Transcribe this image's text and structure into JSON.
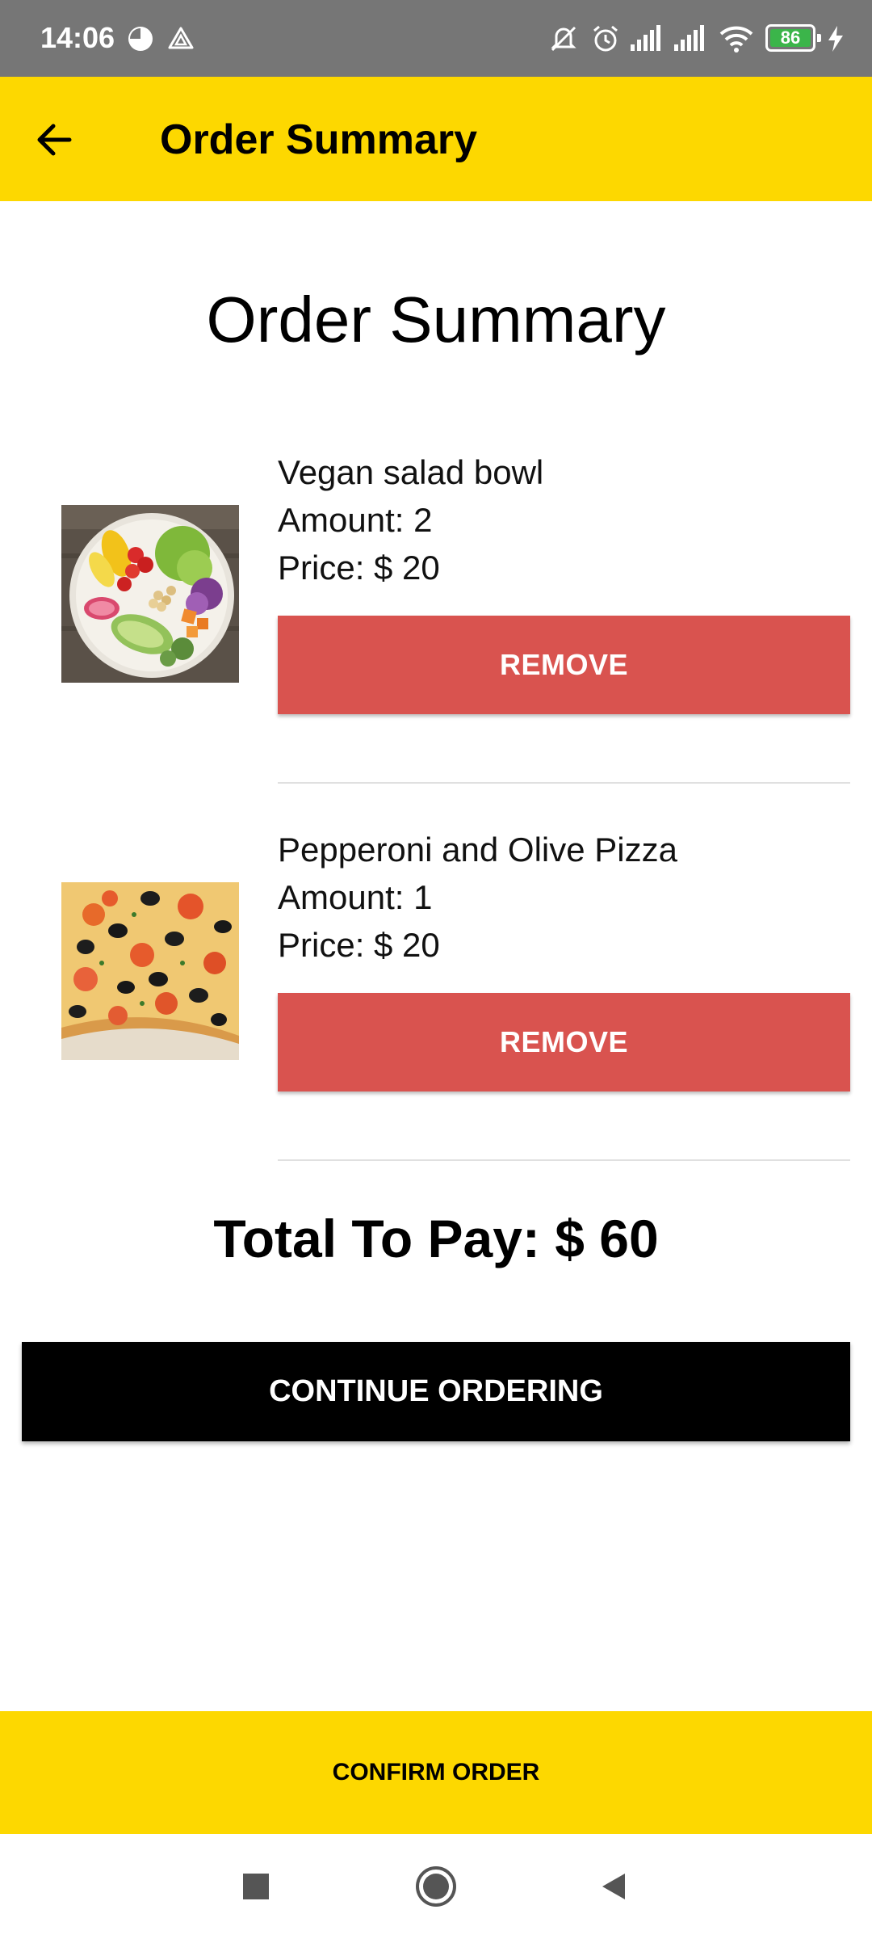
{
  "status_bar": {
    "time": "14:06",
    "battery_level": "86",
    "icons": [
      "pie-chart-icon",
      "triangle-icon",
      "bell-off-icon",
      "alarm-icon",
      "signal-icon",
      "signal-icon",
      "wifi-icon",
      "battery-icon",
      "charging-bolt-icon"
    ]
  },
  "app_bar": {
    "title": "Order Summary",
    "back_icon": "arrow-left-icon"
  },
  "heading": "Order Summary",
  "items": [
    {
      "name": "Vegan salad bowl",
      "amount": "Amount: 2",
      "price": "Price: $ 20",
      "remove_label": "REMOVE"
    },
    {
      "name": "Pepperoni and Olive Pizza",
      "amount": "Amount: 1",
      "price": "Price: $ 20",
      "remove_label": "REMOVE"
    }
  ],
  "total": "Total To Pay: $ 60",
  "continue_label": "CONTINUE ORDERING",
  "confirm_label": "CONFIRM ORDER",
  "colors": {
    "accent_yellow": "#fdd800",
    "remove_red": "#d9534f",
    "continue_black": "#000000",
    "status_bar_gray": "#767676"
  },
  "nav_bar": {
    "icons": [
      "square-recents-icon",
      "circle-home-icon",
      "triangle-back-icon"
    ]
  }
}
